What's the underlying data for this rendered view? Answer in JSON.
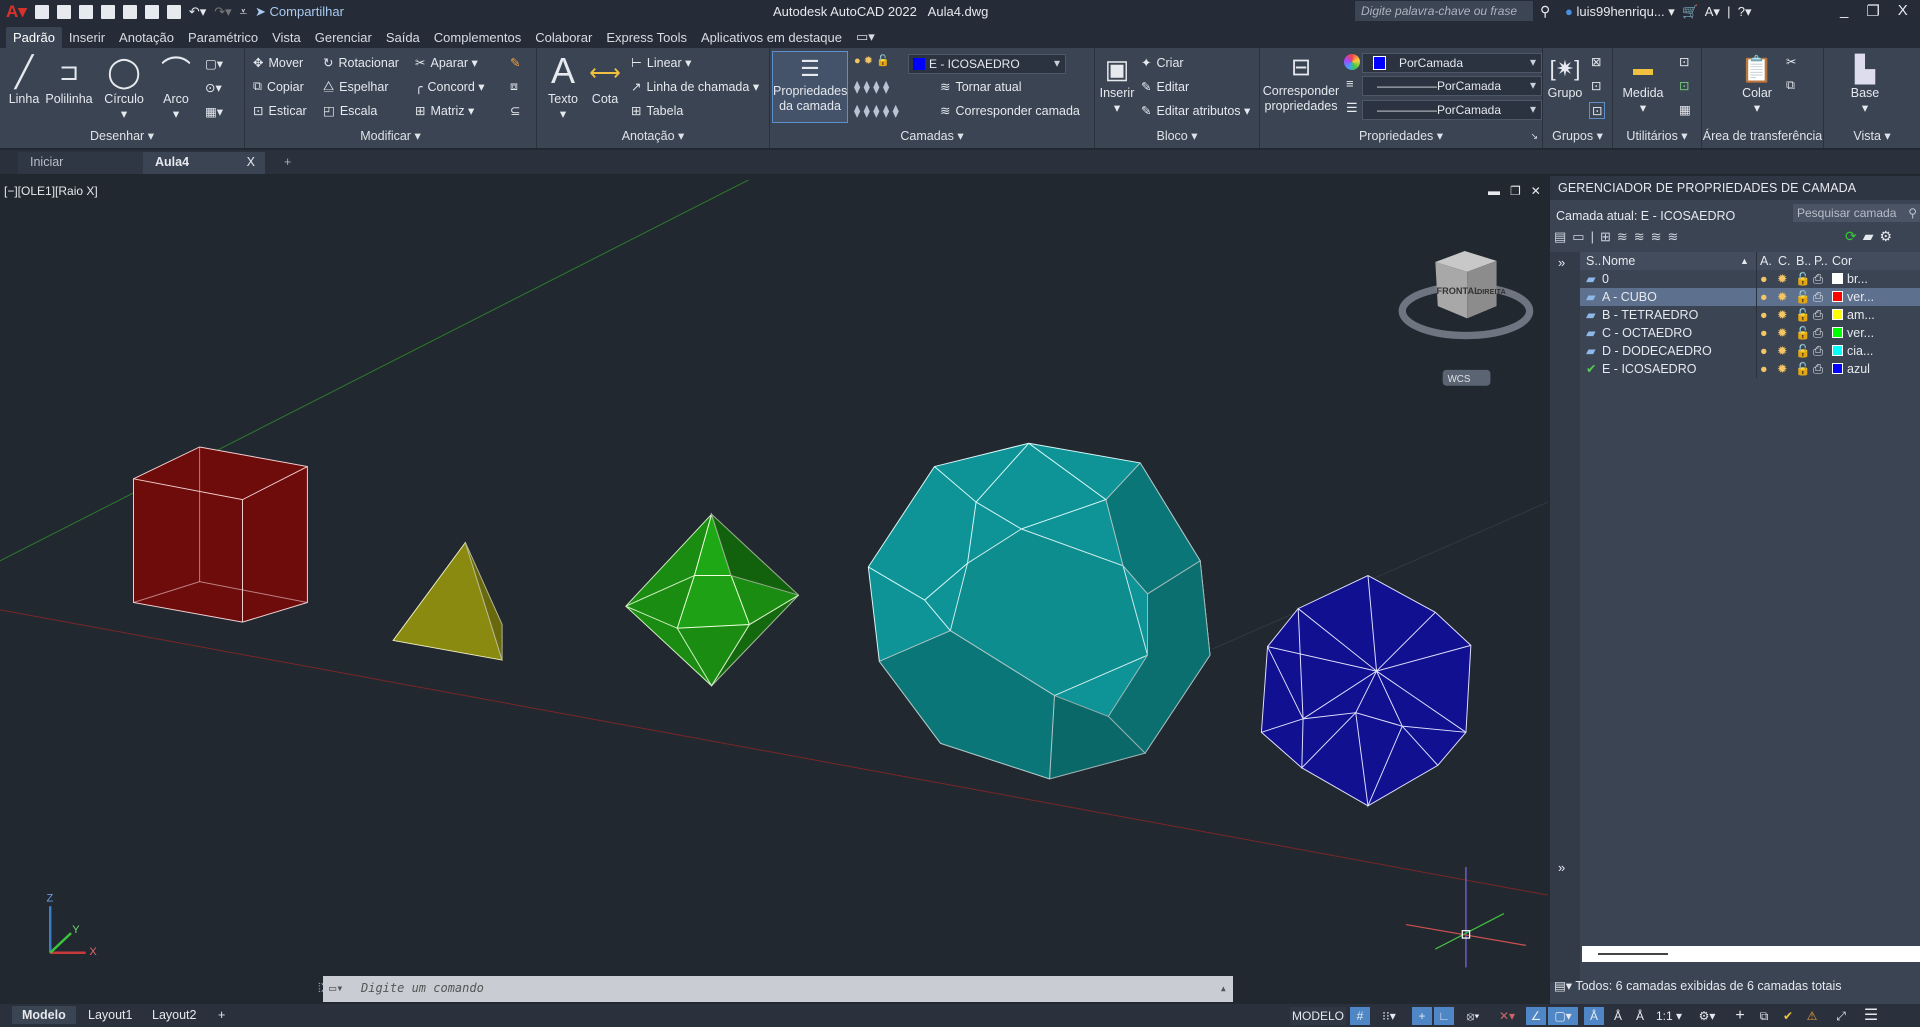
{
  "titlebar": {
    "app_title": "Autodesk AutoCAD 2022",
    "file": "Aula4.dwg",
    "share": "Compartilhar",
    "search_placeholder": "Digite palavra-chave ou frase",
    "user": "luis99henriqu...",
    "minimize": "_",
    "restore": "❐",
    "close": "X"
  },
  "ribbon_tabs": [
    "Padrão",
    "Inserir",
    "Anotação",
    "Paramétrico",
    "Vista",
    "Gerenciar",
    "Saída",
    "Complementos",
    "Colaborar",
    "Express Tools",
    "Aplicativos em destaque"
  ],
  "ribbon": {
    "desenhar": {
      "title": "Desenhar ▾",
      "linha": "Linha",
      "polilinha": "Polilinha",
      "circulo": "Círculo",
      "arco": "Arco"
    },
    "modificar": {
      "title": "Modificar ▾",
      "items": [
        "Mover",
        "Rotacionar",
        "Aparar ▾",
        "Copiar",
        "Espelhar",
        "Concord ▾",
        "Esticar",
        "Escala",
        "Matriz ▾"
      ]
    },
    "anotacao": {
      "title": "Anotação ▾",
      "texto": "Texto",
      "cota": "Cota",
      "linear": "Linear ▾",
      "linha_chamada": "Linha de chamada ▾",
      "tabela": "Tabela"
    },
    "camadas": {
      "title": "Camadas ▾",
      "propriedades": "Propriedades da camada",
      "current_layer": "E - ICOSAEDRO",
      "tornar_atual": "Tornar atual",
      "corresponder": "Corresponder camada"
    },
    "bloco": {
      "title": "Bloco ▾",
      "inserir": "Inserir",
      "criar": "Criar",
      "editar": "Editar",
      "editar_atributos": "Editar atributos ▾"
    },
    "propriedades": {
      "title": "Propriedades ▾",
      "corresponder": "Corresponder propriedades",
      "color": "PorCamada",
      "linetype": "PorCamada",
      "lineweight": "PorCamada"
    },
    "grupos": {
      "title": "Grupos ▾",
      "grupo": "Grupo"
    },
    "utilitarios": {
      "title": "Utilitários ▾",
      "medida": "Medida"
    },
    "transferencia": {
      "title": "Área de transferência",
      "colar": "Colar"
    },
    "vista": {
      "title": "Vista ▾",
      "base": "Base"
    }
  },
  "doc_tabs": {
    "start": "Iniciar",
    "active": "Aula4",
    "close": "X",
    "add": "+"
  },
  "viewport": {
    "label": "[−][OLE1][Raio X]",
    "viewcube_front": "FRONTAL",
    "viewcube_right": "DIREITA",
    "wcs": "WCS"
  },
  "shapes": [
    {
      "name": "cubo",
      "color": "#6e0b0b"
    },
    {
      "name": "tetraedro",
      "color": "#8a8a10"
    },
    {
      "name": "octaedro",
      "color": "#1a8c12"
    },
    {
      "name": "dodecaedro",
      "color": "#0e9496"
    },
    {
      "name": "icosaedro",
      "color": "#101090"
    }
  ],
  "layer_manager": {
    "title": "GERENCIADOR DE PROPRIEDADES DE CAMADA",
    "current": "Camada atual: E - ICOSAEDRO",
    "search_placeholder": "Pesquisar camada",
    "columns": [
      "S..",
      "Nome",
      "A.",
      "C.",
      "B..",
      "P..",
      "Cor"
    ],
    "layers": [
      {
        "name": "0",
        "color": "#ffffff",
        "color_name": "br...",
        "status": "layer"
      },
      {
        "name": "A - CUBO",
        "color": "#ff0000",
        "color_name": "ver...",
        "status": "layer",
        "selected": true
      },
      {
        "name": "B - TETRAEDRO",
        "color": "#ffff00",
        "color_name": "am...",
        "status": "layer"
      },
      {
        "name": "C - OCTAEDRO",
        "color": "#00ff00",
        "color_name": "ver...",
        "status": "layer"
      },
      {
        "name": "D - DODECAEDRO",
        "color": "#00ffff",
        "color_name": "cia...",
        "status": "layer"
      },
      {
        "name": "E - ICOSAEDRO",
        "color": "#0000ff",
        "color_name": "azul",
        "status": "current"
      }
    ],
    "footer": "Todos: 6 camadas exibidas de 6 camadas totais"
  },
  "command": {
    "placeholder": "Digite um comando"
  },
  "status": {
    "tabs": [
      "Modelo",
      "Layout1",
      "Layout2"
    ],
    "add": "+",
    "modelo": "MODELO",
    "scale": "1:1 ▾"
  }
}
